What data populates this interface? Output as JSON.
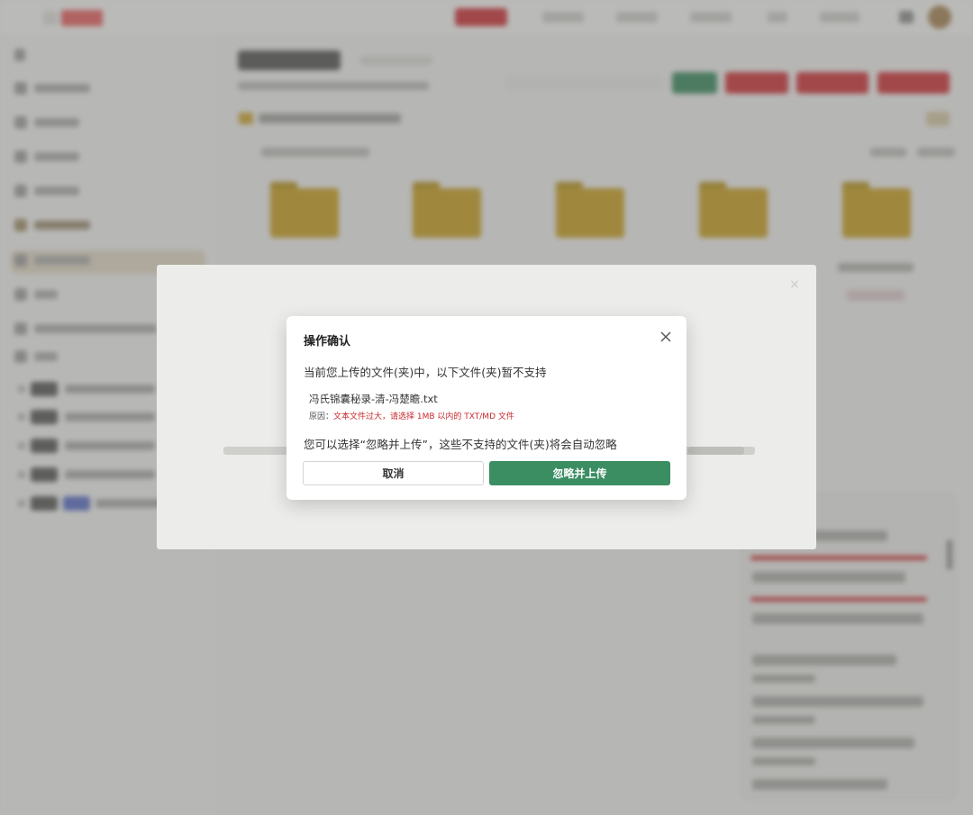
{
  "dialog": {
    "title": "操作确认",
    "message": "当前您上传的文件(夹)中，以下文件(夹)暂不支持",
    "file_name": "冯氏锦囊秘录-清-冯楚瞻.txt",
    "reason_label": "原因：",
    "reason_text": "文本文件过大，请选择 1MB 以内的 TXT/MD 文件",
    "note": "您可以选择“忽略并上传”，这些不支持的文件(夹)将会自动忽略",
    "cancel_label": "取消",
    "confirm_label": "忽略并上传",
    "close_icon": "close-icon"
  },
  "colors": {
    "confirm": "#3b8d62",
    "reason": "#c8282d",
    "brand_red": "#c9373b"
  }
}
